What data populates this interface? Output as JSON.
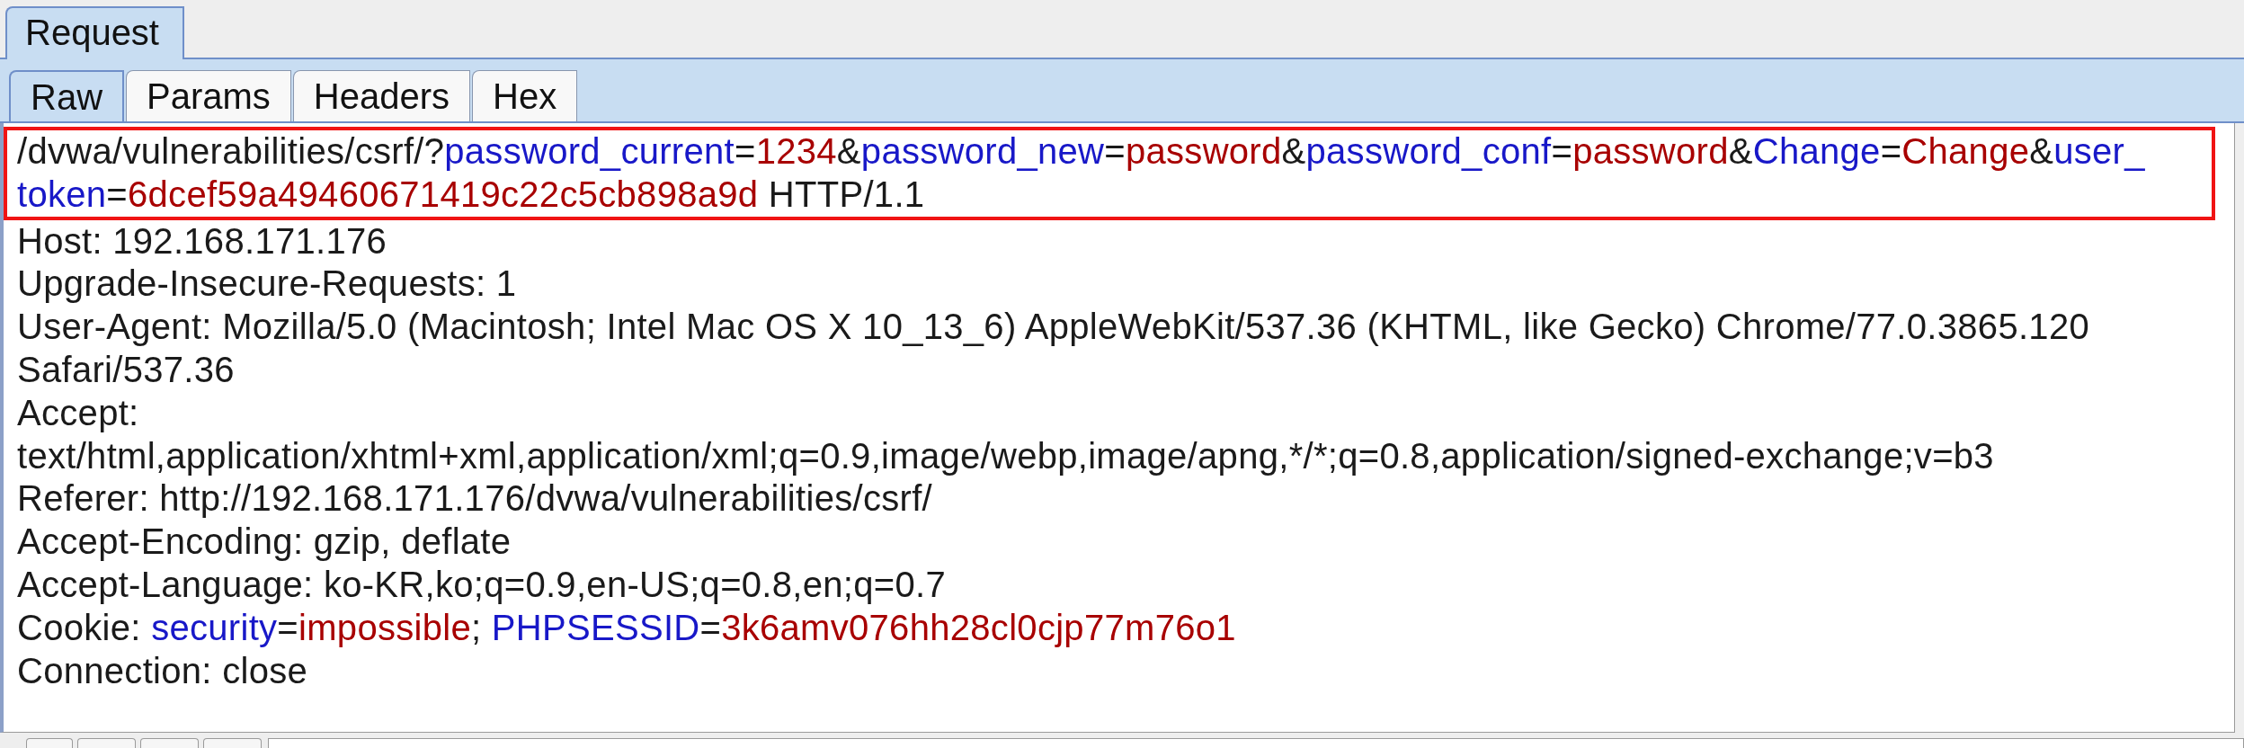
{
  "panel_tab": {
    "label": "Request",
    "selected": true
  },
  "view_tabs": [
    {
      "label": "Raw",
      "selected": true
    },
    {
      "label": "Params",
      "selected": false
    },
    {
      "label": "Headers",
      "selected": false
    },
    {
      "label": "Hex",
      "selected": false
    }
  ],
  "blocks": [
    {
      "highlighted": true,
      "lines": [
        [
          {
            "kind": "text",
            "text": "/dvwa/vulnerabilities/csrf/?"
          },
          {
            "kind": "name",
            "text": "password_current"
          },
          {
            "kind": "text",
            "text": "="
          },
          {
            "kind": "value",
            "text": "1234"
          },
          {
            "kind": "text",
            "text": "&"
          },
          {
            "kind": "name",
            "text": "password_new"
          },
          {
            "kind": "text",
            "text": "="
          },
          {
            "kind": "value",
            "text": "password"
          },
          {
            "kind": "text",
            "text": "&"
          },
          {
            "kind": "name",
            "text": "password_conf"
          },
          {
            "kind": "text",
            "text": "="
          },
          {
            "kind": "value",
            "text": "password"
          },
          {
            "kind": "text",
            "text": "&"
          },
          {
            "kind": "name",
            "text": "Change"
          },
          {
            "kind": "text",
            "text": "="
          },
          {
            "kind": "value",
            "text": "Change"
          },
          {
            "kind": "text",
            "text": "&"
          },
          {
            "kind": "name",
            "text": "user_"
          }
        ],
        [
          {
            "kind": "name",
            "text": "token"
          },
          {
            "kind": "text",
            "text": "="
          },
          {
            "kind": "value",
            "text": "6dcef59a49460671419c22c5cb898a9d"
          },
          {
            "kind": "text",
            "text": " HTTP/1.1"
          }
        ]
      ]
    },
    {
      "highlighted": false,
      "lines": [
        [
          {
            "kind": "text",
            "text": "Host: 192.168.171.176"
          }
        ],
        [
          {
            "kind": "text",
            "text": "Upgrade-Insecure-Requests: 1"
          }
        ],
        [
          {
            "kind": "text",
            "text": "User-Agent: Mozilla/5.0 (Macintosh; Intel Mac OS X 10_13_6) AppleWebKit/537.36 (KHTML, like Gecko) Chrome/77.0.3865.120"
          }
        ],
        [
          {
            "kind": "text",
            "text": "Safari/537.36"
          }
        ],
        [
          {
            "kind": "text",
            "text": "Accept:"
          }
        ],
        [
          {
            "kind": "text",
            "text": "text/html,application/xhtml+xml,application/xml;q=0.9,image/webp,image/apng,*/*;q=0.8,application/signed-exchange;v=b3"
          }
        ],
        [
          {
            "kind": "text",
            "text": "Referer: http://192.168.171.176/dvwa/vulnerabilities/csrf/"
          }
        ],
        [
          {
            "kind": "text",
            "text": "Accept-Encoding: gzip, deflate"
          }
        ],
        [
          {
            "kind": "text",
            "text": "Accept-Language: ko-KR,ko;q=0.9,en-US;q=0.8,en;q=0.7"
          }
        ],
        [
          {
            "kind": "text",
            "text": "Cookie: "
          },
          {
            "kind": "name",
            "text": "security"
          },
          {
            "kind": "text",
            "text": "="
          },
          {
            "kind": "value",
            "text": "impossible"
          },
          {
            "kind": "text",
            "text": "; "
          },
          {
            "kind": "name",
            "text": "PHPSESSID"
          },
          {
            "kind": "text",
            "text": "="
          },
          {
            "kind": "value",
            "text": "3k6amv076hh28cl0cjp77m76o1"
          }
        ],
        [
          {
            "kind": "text",
            "text": "Connection: close"
          }
        ]
      ]
    }
  ]
}
